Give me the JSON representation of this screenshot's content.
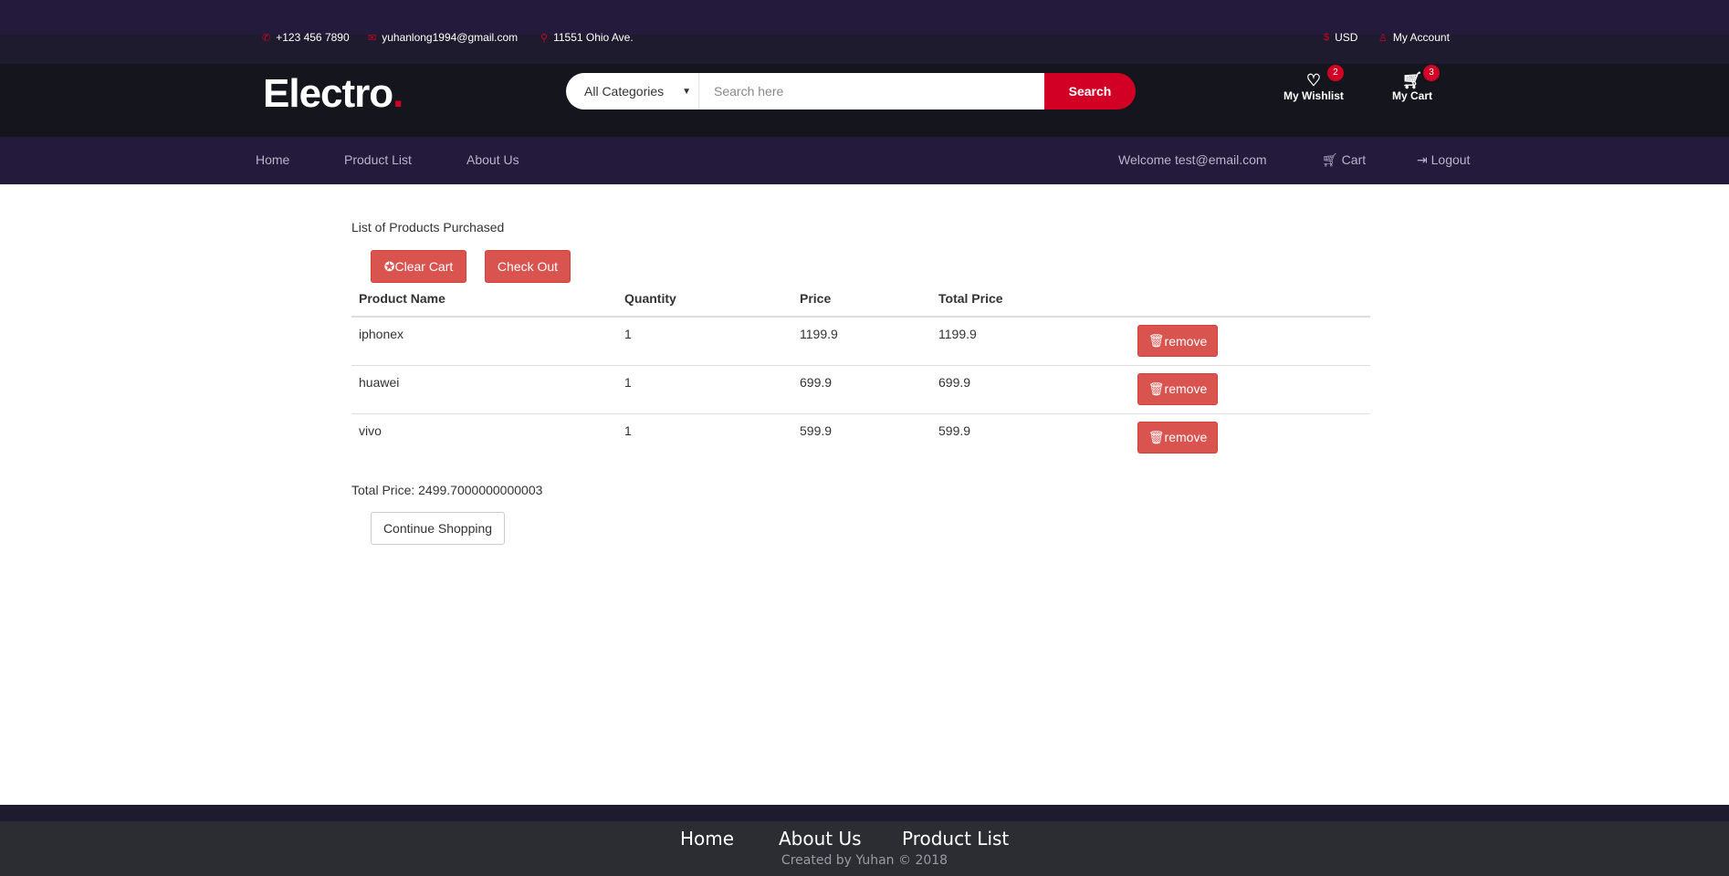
{
  "top_bar": {
    "phone": "+123 456 7890",
    "email": "yuhanlong1994@gmail.com",
    "address": "11551 Ohio Ave.",
    "currency": "USD",
    "account": "My Account"
  },
  "header": {
    "logo": "Electro",
    "logo_dot": ".",
    "category": "All Categories",
    "search_placeholder": "Search here",
    "search_button": "Search",
    "wishlist_label": "My Wishlist",
    "wishlist_count": "2",
    "cart_label": "My Cart",
    "cart_count": "3"
  },
  "nav": {
    "home": "Home",
    "product_list": "Product List",
    "about": "About Us",
    "welcome": "Welcome test@email.com",
    "cart": "Cart",
    "logout": "Logout"
  },
  "main": {
    "title": "List of Products Purchased",
    "clear_cart": "Clear Cart",
    "check_out": "Check Out",
    "columns": [
      "Product Name",
      "Quantity",
      "Price",
      "Total Price"
    ],
    "rows": [
      {
        "name": "iphonex",
        "qty": "1",
        "price": "1199.9",
        "total": "1199.9",
        "action": "remove"
      },
      {
        "name": "huawei",
        "qty": "1",
        "price": "699.9",
        "total": "699.9",
        "action": "remove"
      },
      {
        "name": "vivo",
        "qty": "1",
        "price": "599.9",
        "total": "599.9",
        "action": "remove"
      }
    ],
    "total_label": "Total Price: 2499.7000000000003",
    "continue": "Continue Shopping"
  },
  "footer": {
    "links": [
      "Home",
      "About Us",
      "Product List"
    ],
    "credit": "Created by Yuhan © 2018"
  },
  "colors": {
    "accent": "#d10024",
    "nav_bg": "#241a3b",
    "header_bg": "#15161d",
    "danger": "#d9534f"
  }
}
